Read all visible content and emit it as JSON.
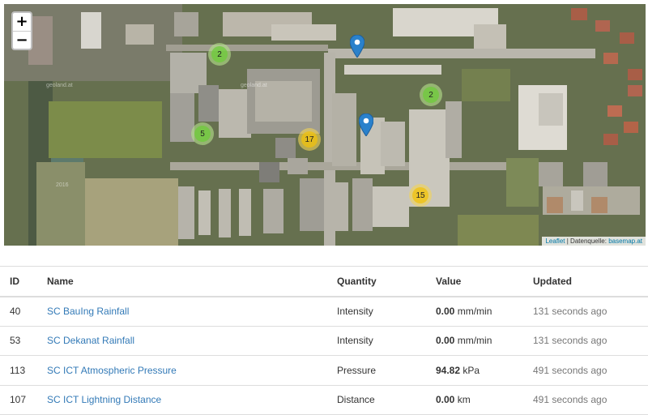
{
  "map": {
    "zoom_in_label": "+",
    "zoom_out_label": "−",
    "clusters": [
      {
        "count": "2",
        "color": "green"
      },
      {
        "count": "2",
        "color": "green"
      },
      {
        "count": "5",
        "color": "green"
      },
      {
        "count": "17",
        "color": "yellow"
      },
      {
        "count": "15",
        "color": "yellow"
      }
    ],
    "attribution": {
      "leaflet": "Leaflet",
      "separator": " | Datenquelle: ",
      "source": "basemap.at"
    },
    "watermarks": [
      "geoland.at",
      "geoland.at",
      "2016"
    ],
    "pin_color": "#2a81cb"
  },
  "table": {
    "headers": [
      "ID",
      "Name",
      "Quantity",
      "Value",
      "Updated"
    ],
    "rows": [
      {
        "id": "40",
        "name": "SC BauIng Rainfall",
        "quantity": "Intensity",
        "value": "0.00",
        "unit": "mm/min",
        "updated": "131 seconds ago"
      },
      {
        "id": "53",
        "name": "SC Dekanat Rainfall",
        "quantity": "Intensity",
        "value": "0.00",
        "unit": "mm/min",
        "updated": "131 seconds ago"
      },
      {
        "id": "113",
        "name": "SC ICT Atmospheric Pressure",
        "quantity": "Pressure",
        "value": "94.82",
        "unit": "kPa",
        "updated": "491 seconds ago"
      },
      {
        "id": "107",
        "name": "SC ICT Lightning Distance",
        "quantity": "Distance",
        "value": "0.00",
        "unit": "km",
        "updated": "491 seconds ago"
      }
    ]
  }
}
